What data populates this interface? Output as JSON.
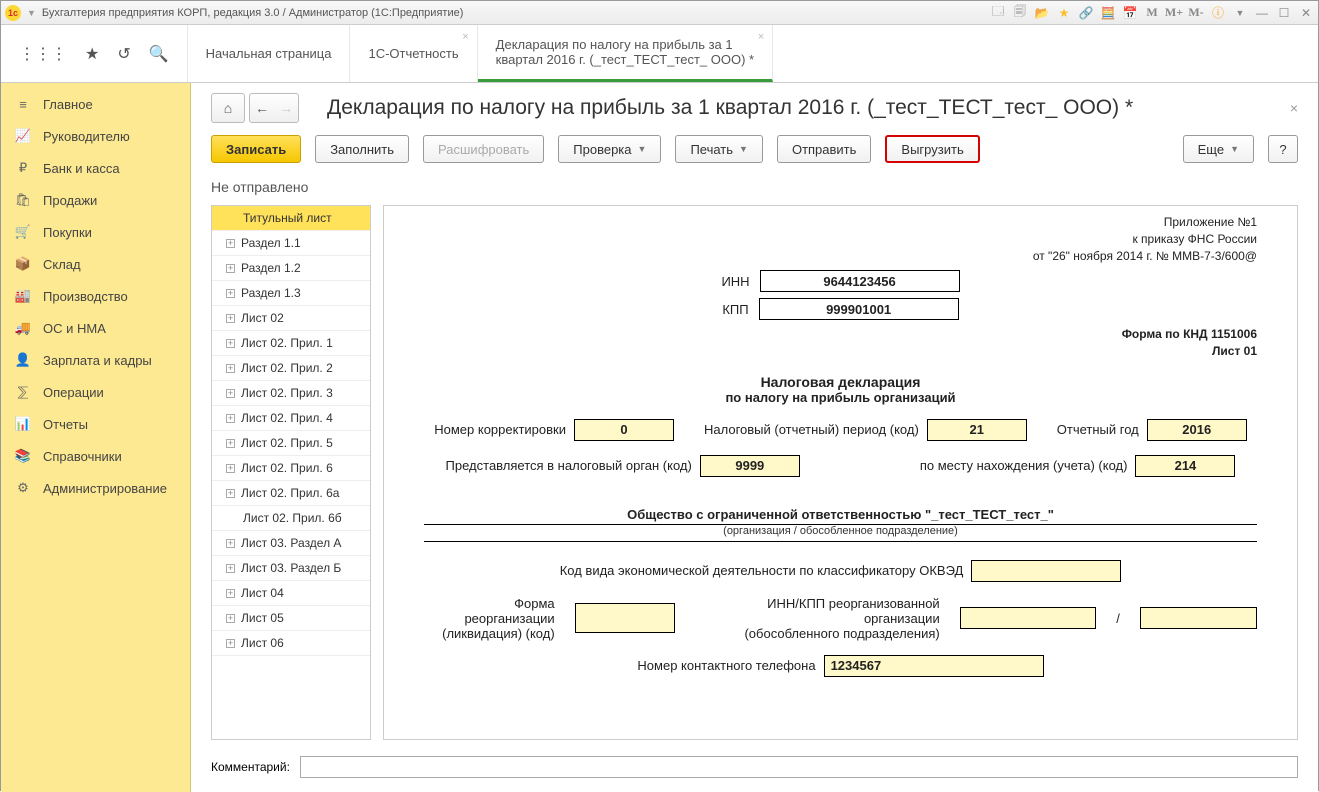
{
  "titlebar": {
    "title": "Бухгалтерия предприятия КОРП, редакция 3.0 / Администратор  (1С:Предприятие)"
  },
  "tabs": {
    "home": "Начальная страница",
    "t1": "1С-Отчетность",
    "t2a": "Декларация по налогу на прибыль за 1",
    "t2b": "квартал 2016 г. (_тест_ТЕСТ_тест_ ООО) *"
  },
  "sidebar": [
    {
      "icon": "≡",
      "label": "Главное"
    },
    {
      "icon": "📈",
      "label": "Руководителю"
    },
    {
      "icon": "₽",
      "label": "Банк и касса"
    },
    {
      "icon": "🛍",
      "label": "Продажи"
    },
    {
      "icon": "🛒",
      "label": "Покупки"
    },
    {
      "icon": "📦",
      "label": "Склад"
    },
    {
      "icon": "🏭",
      "label": "Производство"
    },
    {
      "icon": "🚚",
      "label": "ОС и НМА"
    },
    {
      "icon": "👤",
      "label": "Зарплата и кадры"
    },
    {
      "icon": "⅀",
      "label": "Операции"
    },
    {
      "icon": "📊",
      "label": "Отчеты"
    },
    {
      "icon": "📚",
      "label": "Справочники"
    },
    {
      "icon": "⚙",
      "label": "Администрирование"
    }
  ],
  "page": {
    "title": "Декларация по налогу на прибыль за 1 квартал 2016 г. (_тест_ТЕСТ_тест_ ООО) *",
    "status": "Не отправлено",
    "comment_label": "Комментарий:"
  },
  "toolbar": {
    "write": "Записать",
    "fill": "Заполнить",
    "decode": "Расшифровать",
    "check": "Проверка",
    "print": "Печать",
    "send": "Отправить",
    "export": "Выгрузить",
    "more": "Еще",
    "help": "?"
  },
  "tree": [
    "Титульный лист",
    "Раздел 1.1",
    "Раздел 1.2",
    "Раздел 1.3",
    "Лист 02",
    "Лист 02. Прил. 1",
    "Лист 02. Прил. 2",
    "Лист 02. Прил. 3",
    "Лист 02. Прил. 4",
    "Лист 02. Прил. 5",
    "Лист 02. Прил. 6",
    "Лист 02. Прил. 6а",
    "Лист 02. Прил. 6б",
    "Лист 03. Раздел А",
    "Лист 03. Раздел Б",
    "Лист 04",
    "Лист 05",
    "Лист 06"
  ],
  "form": {
    "app1": "Приложение №1",
    "app2": "к приказу ФНС России",
    "app3": "от \"26\" ноября 2014 г. № ММВ-7-3/600@",
    "inn_l": "ИНН",
    "inn": "9644123456",
    "kpp_l": "КПП",
    "kpp": "999901001",
    "knd": "Форма по КНД 1151006",
    "sheet": "Лист 01",
    "h1": "Налоговая декларация",
    "h2": "по налогу на прибыль организаций",
    "corr_l": "Номер корректировки",
    "corr": "0",
    "period_l": "Налоговый (отчетный) период (код)",
    "period": "21",
    "year_l": "Отчетный год",
    "year": "2016",
    "organ_l": "Представляется в налоговый орган (код)",
    "organ": "9999",
    "place_l": "по месту нахождения (учета) (код)",
    "place": "214",
    "org": "Общество с ограниченной ответственностью \"_тест_ТЕСТ_тест_\"",
    "orgsub": "(организация / обособленное подразделение)",
    "okved_l": "Код вида экономической деятельности по классификатору ОКВЭД",
    "reorg_l1": "Форма реорганизации",
    "reorg_l2": "(ликвидация) (код)",
    "reorg2_l1": "ИНН/КПП реорганизованной организации",
    "reorg2_l2": "(обособленного подразделения)",
    "slash": "/",
    "phone_l": "Номер контактного телефона",
    "phone": "1234567"
  }
}
